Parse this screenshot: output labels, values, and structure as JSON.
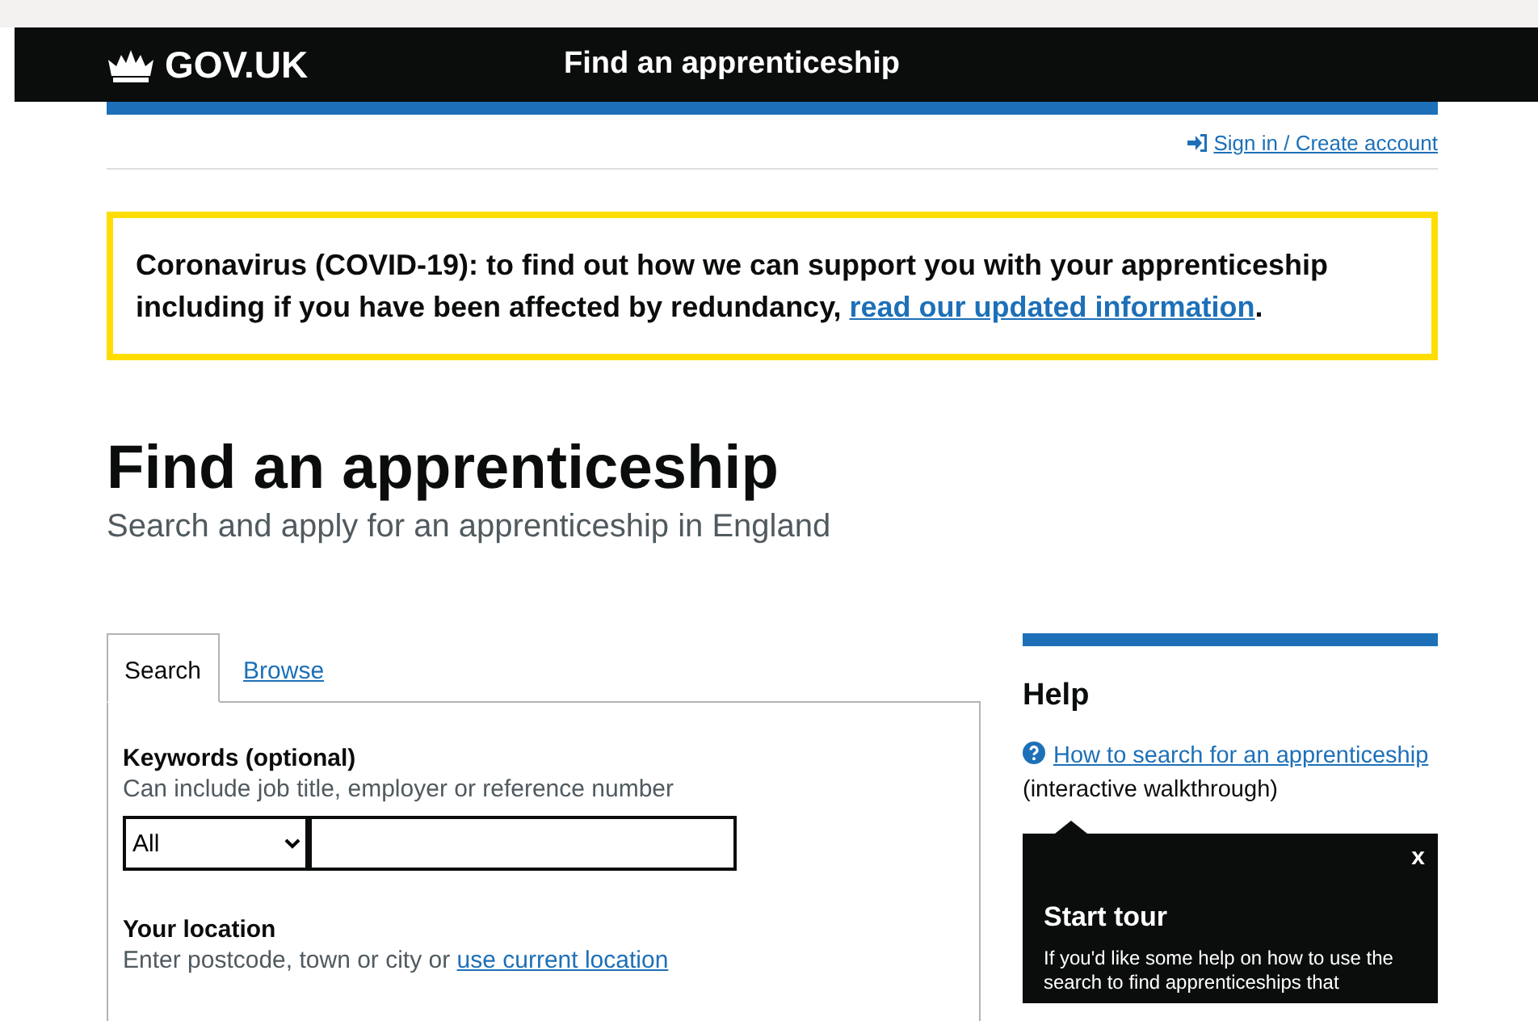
{
  "header": {
    "logo": "GOV.UK",
    "service": "Find an apprenticeship"
  },
  "account_link": "Sign in / Create account",
  "banner": {
    "text": "Coronavirus (COVID-19): to find out how we can support you with your apprenticeship including if you have been affected by redundancy, ",
    "link": "read our updated information",
    "end": "."
  },
  "title": "Find an apprenticeship",
  "subtitle": "Search and apply for an apprenticeship in England",
  "tabs": [
    {
      "label": "Search",
      "selected": true
    },
    {
      "label": "Browse",
      "selected": false
    }
  ],
  "keywords": {
    "label": "Keywords (optional)",
    "hint": "Can include job title, employer or reference number",
    "select_value": "All"
  },
  "location": {
    "label": "Your location",
    "hint": "Enter postcode, town or city or ",
    "link": "use current location"
  },
  "help": {
    "heading": "Help",
    "link": "How to search for an apprenticeship",
    "after": " (interactive walkthrough)"
  },
  "tour": {
    "close": "x",
    "title": "Start tour",
    "text": "If you'd like some help on how to use the search to find apprenticeships that"
  }
}
